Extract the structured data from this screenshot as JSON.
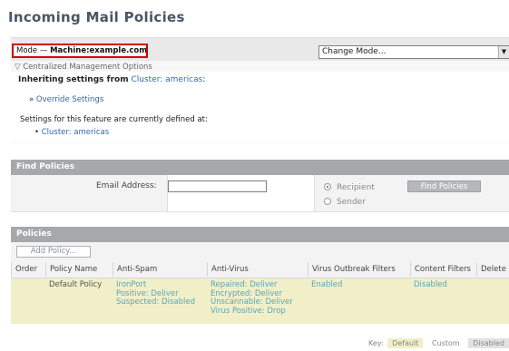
{
  "page_title": "Incoming Mail Policies",
  "mode": {
    "prefix": "Mode —",
    "machine": "Machine:example.com",
    "change_mode_placeholder": "Change Mode..."
  },
  "centralized": {
    "options_label": "Centralized Management Options",
    "inherit_prefix": "Inheriting settings from",
    "inherit_cluster_link": "Cluster: americas",
    "inherit_suffix": ":",
    "override_link": "Override Settings",
    "defined_at_text": "Settings for this feature are currently defined at:",
    "defined_cluster_link": "Cluster: americas"
  },
  "find_policies": {
    "header": "Find Policies",
    "email_label": "Email Address:",
    "email_value": "",
    "recipient_label": "Recipient",
    "sender_label": "Sender",
    "selected": "Recipient",
    "button_label": "Find Policies"
  },
  "policies": {
    "header": "Policies",
    "add_label": "Add Policy...",
    "columns": [
      "Order",
      "Policy Name",
      "Anti-Spam",
      "Anti-Virus",
      "Virus Outbreak Filters",
      "Content Filters",
      "Delete"
    ],
    "rows": [
      {
        "order": "",
        "name": "Default Policy",
        "anti_spam": [
          "IronPort",
          "Positive: Deliver",
          "Suspected: Disabled"
        ],
        "anti_virus": [
          "Repaired: Deliver",
          "Encrypted: Deliver",
          "Unscannable: Deliver",
          "Virus Positive: Drop"
        ],
        "vof": "Enabled",
        "content_filters": "Disabled"
      }
    ]
  },
  "key": {
    "label": "Key:",
    "default": "Default",
    "custom": "Custom",
    "disabled": "Disabled"
  },
  "colors": {
    "mode_highlight": "#d40000",
    "section_header": "#a6a8ab",
    "default_row": "#f0efc8",
    "link": "#3366aa",
    "value_text": "#5aa4b8"
  }
}
